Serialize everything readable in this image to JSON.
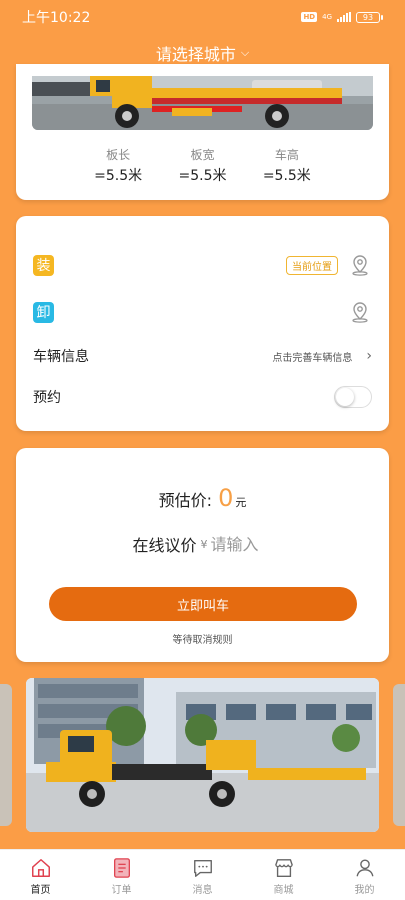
{
  "status_bar": {
    "time": "上午10:22",
    "hd": "HD",
    "network": "4G",
    "battery": "93"
  },
  "header": {
    "city_label": "请选择城市",
    "dropdown_icon": "chevron-down-icon"
  },
  "truck_card": {
    "specs": [
      {
        "label": "板长",
        "value": "=5.5米"
      },
      {
        "label": "板宽",
        "value": "=5.5米"
      },
      {
        "label": "车高",
        "value": "=5.5米"
      }
    ]
  },
  "order_form": {
    "load_tag": "装",
    "unload_tag": "卸",
    "current_location": "当前位置",
    "vehicle_info_label": "车辆信息",
    "vehicle_info_hint": "点击完善车辆信息",
    "vehicle_info_arrow": "›",
    "reserve_label": "预约",
    "reserve_enabled": false
  },
  "pricing": {
    "estimate_label": "预估价:",
    "estimate_value": "0",
    "estimate_unit": "元",
    "bargain_label": "在线议价",
    "currency_symbol": "¥",
    "bargain_placeholder": "请输入",
    "call_button": "立即叫车",
    "cancel_rules_link": "等待取消规则"
  },
  "colors": {
    "background": "#fb9d46",
    "primary_button": "#e56b10",
    "load_tag": "#f5b722",
    "unload_tag": "#29b9e4",
    "price_highlight": "#f7a046"
  },
  "tab_bar": {
    "active_index": 0,
    "tabs": [
      {
        "label": "首页",
        "icon": "home-icon"
      },
      {
        "label": "订单",
        "icon": "order-list-icon"
      },
      {
        "label": "消息",
        "icon": "message-icon"
      },
      {
        "label": "商城",
        "icon": "shop-icon"
      },
      {
        "label": "我的",
        "icon": "profile-icon"
      }
    ]
  }
}
